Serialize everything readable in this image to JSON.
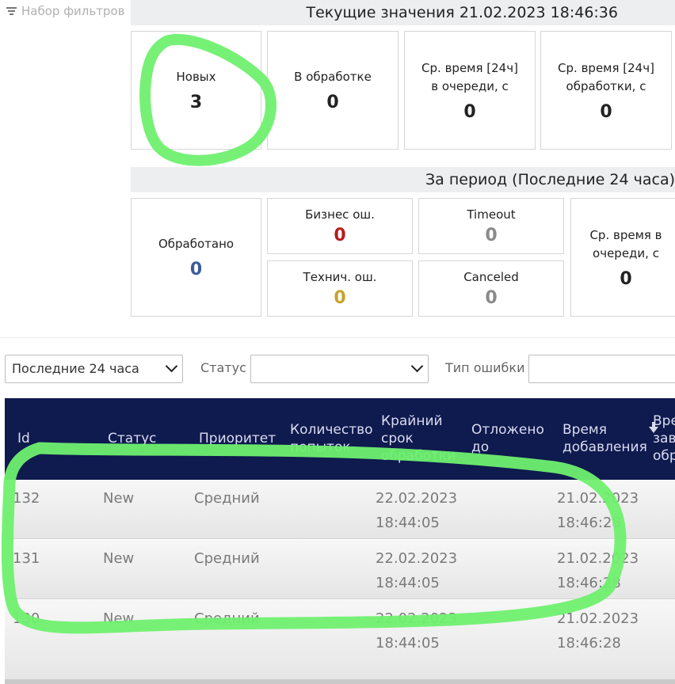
{
  "filter_set": {
    "label": "Набор фильтров"
  },
  "current": {
    "title": "Текущие значения 21.02.2023 18:46:36",
    "cards": [
      {
        "label": "Новых",
        "value": "3"
      },
      {
        "label": "В обработке",
        "value": "0"
      },
      {
        "label_lines": [
          "Ср. время [24ч]",
          "в очереди, с"
        ],
        "value": "0"
      },
      {
        "label_lines": [
          "Ср. время [24ч]",
          "обработки, с"
        ],
        "value": "0"
      }
    ]
  },
  "period": {
    "title": "За период (Последние 24 часа)",
    "processed": {
      "label": "Обработано",
      "value": "0"
    },
    "business_errors": {
      "label": "Бизнес ош.",
      "value": "0"
    },
    "tech_errors": {
      "label": "Технич. ош.",
      "value": "0"
    },
    "timeout": {
      "label": "Timeout",
      "value": "0"
    },
    "canceled": {
      "label": "Canceled",
      "value": "0"
    },
    "avg_queue": {
      "label_lines": [
        "Ср. время в",
        "очереди, с"
      ],
      "value": "0"
    }
  },
  "filters": {
    "period_value": "Последние 24 часа",
    "status_label": "Статус",
    "status_value": "",
    "error_type_label": "Тип ошибки"
  },
  "colors": {
    "header_bg": "#0f1a4e",
    "processed": "#3d5c99",
    "business_error": "#b71c1c",
    "tech_error": "#c8a22c",
    "muted": "#8a8a8a",
    "annotation": "#6ff06f"
  },
  "table": {
    "columns": [
      {
        "lines": [
          "Id"
        ]
      },
      {
        "lines": [
          "Статус"
        ]
      },
      {
        "lines": [
          "Приоритет"
        ]
      },
      {
        "lines": [
          "Количество",
          "попыток"
        ]
      },
      {
        "lines": [
          "Крайний",
          "срок",
          "обработки"
        ]
      },
      {
        "lines": [
          "Отложено",
          "до"
        ]
      },
      {
        "lines": [
          "Время",
          "добавления"
        ]
      },
      {
        "lines": [
          "Вре",
          "зав",
          "обр"
        ]
      }
    ],
    "rows": [
      {
        "id": "132",
        "status": "New",
        "priority": "Средний",
        "deadline_date": "22.02.2023",
        "deadline_time": "18:44:05",
        "added_date": "21.02.2023",
        "added_time": "18:46:28"
      },
      {
        "id": "131",
        "status": "New",
        "priority": "Средний",
        "deadline_date": "22.02.2023",
        "deadline_time": "18:44:05",
        "added_date": "21.02.2023",
        "added_time": "18:46:28"
      },
      {
        "id": "130",
        "status": "New",
        "priority": "Средний",
        "deadline_date": "22.02.2023",
        "deadline_time": "18:44:05",
        "added_date": "21.02.2023",
        "added_time": "18:46:28"
      }
    ]
  }
}
